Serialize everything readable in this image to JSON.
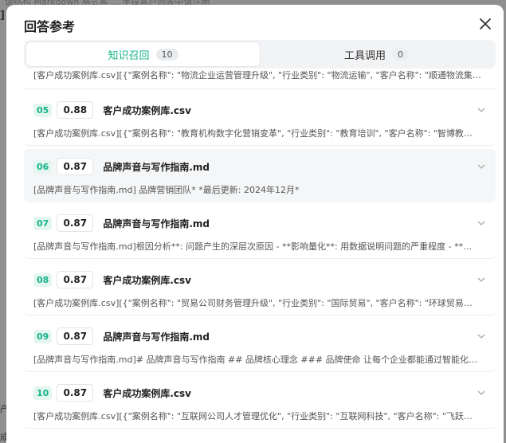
{
  "backdrop": {
    "top_text": "请结构 Markdown 格式客 ... 手撑客户回答中请注明",
    "left_text_1": "]",
    "left_text_2": "产",
    "left_text_3": "成"
  },
  "modal": {
    "title": "回答参考",
    "tabs": [
      {
        "label": "知识召回",
        "count": "10",
        "active": true
      },
      {
        "label": "工具调用",
        "count": "0",
        "active": false
      }
    ],
    "partial_row": "[客户成功案例库.csv][{\"案例名称\": \"物流企业运营管理升级\", \"行业类别\": \"物流运输\", \"客户名称\": \"顺通物流集团...",
    "items": [
      {
        "index": "05",
        "score": "0.88",
        "file": "客户成功案例库.csv",
        "snippet": "[客户成功案例库.csv][{\"案例名称\": \"教育机构数字化营销变革\", \"行业类别\": \"教育培训\", \"客户名称\": \"智博教育集..."
      },
      {
        "index": "06",
        "score": "0.87",
        "file": "品牌声音与写作指南.md",
        "snippet": "[品牌声音与写作指南.md] 品牌营销团队* *最后更新: 2024年12月*"
      },
      {
        "index": "07",
        "score": "0.87",
        "file": "品牌声音与写作指南.md",
        "snippet": "[品牌声音与写作指南.md]根因分析**: 问题产生的深层次原因 - **影响量化**: 用数据说明问题的严重程度 - **趋势..."
      },
      {
        "index": "08",
        "score": "0.87",
        "file": "客户成功案例库.csv",
        "snippet": "[客户成功案例库.csv][{\"案例名称\": \"贸易公司财务管理升级\", \"行业类别\": \"国际贸易\", \"客户名称\": \"环球贸易有限..."
      },
      {
        "index": "09",
        "score": "0.87",
        "file": "品牌声音与写作指南.md",
        "snippet": "[品牌声音与写作指南.md]# 品牌声音与写作指南 ## 品牌核心理念 ### 品牌使命 让每个企业都能通过智能化CRM..."
      },
      {
        "index": "10",
        "score": "0.87",
        "file": "客户成功案例库.csv",
        "snippet": "[客户成功案例库.csv][{\"案例名称\": \"互联网公司人才管理优化\", \"行业类别\": \"互联网科技\", \"客户名称\": \"飞跃网络..."
      }
    ]
  },
  "colors": {
    "accent": "#15b389",
    "hover_row": "#f5f6f7"
  }
}
